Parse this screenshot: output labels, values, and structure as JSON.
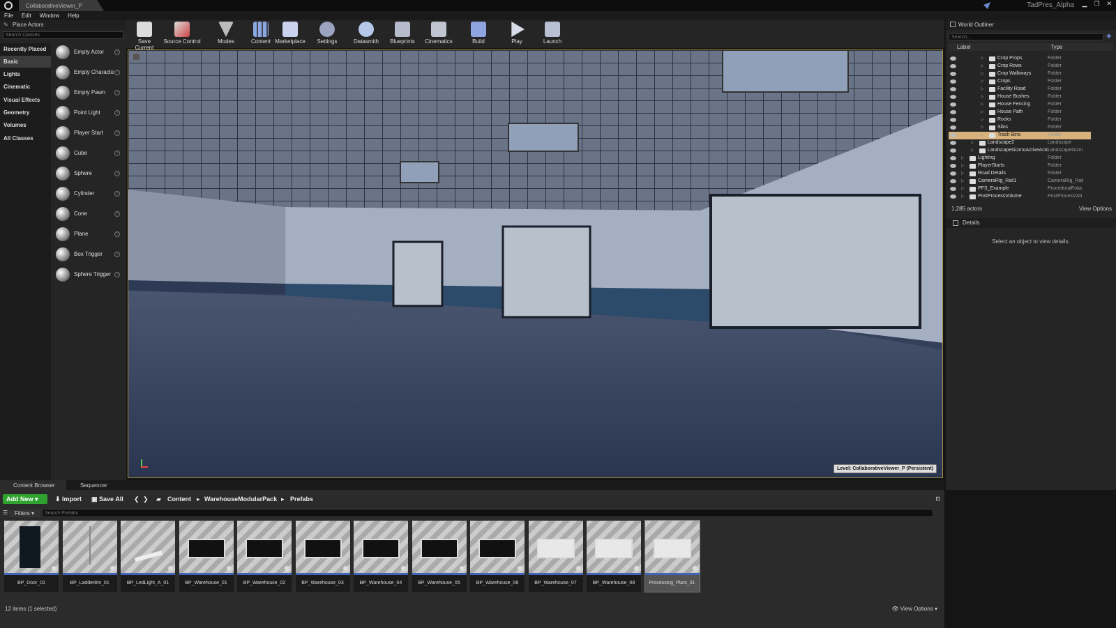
{
  "title_bar": {
    "doc_tab": "CollaborativeViewer_P",
    "project": "TadPres_Alpha"
  },
  "menu": [
    "File",
    "Edit",
    "Window",
    "Help"
  ],
  "place_actors": {
    "header": "Place Actors",
    "search_placeholder": "Search Classes",
    "categories": [
      "Recently Placed",
      "Basic",
      "Lights",
      "Cinematic",
      "Visual Effects",
      "Geometry",
      "Volumes",
      "All Classes"
    ],
    "selected_category": "Basic",
    "actors": [
      "Empty Actor",
      "Empty Characte",
      "Empty Pawn",
      "Point Light",
      "Player Start",
      "Cube",
      "Sphere",
      "Cylinder",
      "Cone",
      "Plane",
      "Box Trigger",
      "Sphere Trigger"
    ]
  },
  "toolbar": [
    "Save Current",
    "Source Control",
    "Modes",
    "Content",
    "Marketplace",
    "Settings",
    "Datasmith",
    "Blueprints",
    "Cinematics",
    "Build",
    "Play",
    "Launch"
  ],
  "viewport": {
    "level": "Level:  CollaborativeViewer_P (Persistent)"
  },
  "world_outliner": {
    "header": "World Outliner",
    "search_placeholder": "Search...",
    "col_label": "Label",
    "col_type": "Type",
    "rows": [
      {
        "label": "Crop Props",
        "type": "Folder",
        "indent": 2
      },
      {
        "label": "Crop Rows",
        "type": "Folder",
        "indent": 2
      },
      {
        "label": "Crop Walkways",
        "type": "Folder",
        "indent": 2
      },
      {
        "label": "Crops",
        "type": "Folder",
        "indent": 2
      },
      {
        "label": "Facility Road",
        "type": "Folder",
        "indent": 2
      },
      {
        "label": "House Bushes",
        "type": "Folder",
        "indent": 2
      },
      {
        "label": "House Fencing",
        "type": "Folder",
        "indent": 2
      },
      {
        "label": "House Path",
        "type": "Folder",
        "indent": 2
      },
      {
        "label": "Rocks",
        "type": "Folder",
        "indent": 2
      },
      {
        "label": "Silos",
        "type": "Folder",
        "indent": 2
      },
      {
        "label": "Trash Bins",
        "type": "Folder",
        "indent": 2,
        "selected": true
      },
      {
        "label": "Landscape2",
        "type": "Landscape",
        "indent": 1
      },
      {
        "label": "LandscapeGizmoActiveActo",
        "type": "LandscapeGizm",
        "indent": 1
      },
      {
        "label": "Lighting",
        "type": "Folder",
        "indent": 0
      },
      {
        "label": "PlayerStarts",
        "type": "Folder",
        "indent": 0
      },
      {
        "label": "Road Details",
        "type": "Folder",
        "indent": 0
      },
      {
        "label": "CameraRig_Rail1",
        "type": "CameraRig_Rail",
        "indent": 0
      },
      {
        "label": "PFS_Example",
        "type": "ProceduralFolia",
        "indent": 0
      },
      {
        "label": "PostProcessVolume",
        "type": "PostProcessVol",
        "indent": 0
      }
    ],
    "actor_count": "1,285 actors",
    "view_options": "View Options"
  },
  "details": {
    "header": "Details",
    "message": "Select an object to view details."
  },
  "content_browser": {
    "tabs": [
      "Content Browser",
      "Sequencer"
    ],
    "add_new": "Add New",
    "import": "Import",
    "save_all": "Save All",
    "path": [
      "Content",
      "WarehouseModularPack",
      "Prefabs"
    ],
    "filters": "Filters",
    "search_placeholder": "Search Prefabs",
    "assets": [
      "BP_Door_01",
      "BP_Ladder8m_01",
      "BP_LedLight_A_01",
      "BP_Warehouse_01",
      "BP_Warehouse_02",
      "BP_Warehouse_03",
      "BP_Warehouse_04",
      "BP_Warehouse_05",
      "BP_Warehouse_06",
      "BP_Warehouse_07",
      "BP_Warehouse_08",
      "Processing_Plant_01"
    ],
    "selected_asset": "Processing_Plant_01",
    "status": "12 items (1 selected)",
    "view_options": "View Options"
  }
}
